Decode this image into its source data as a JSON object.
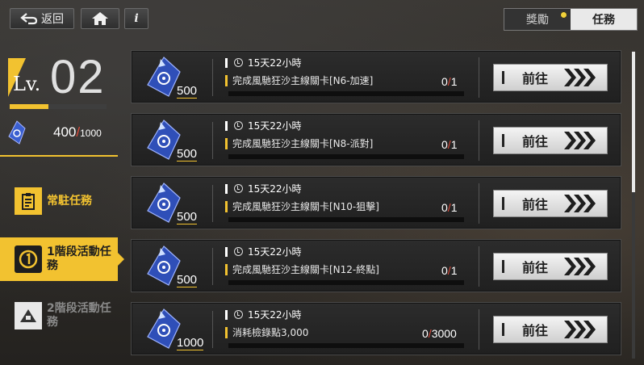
{
  "topbar": {
    "back_label": "返回",
    "info_label": "i",
    "tabs": [
      {
        "label": "獎勵"
      },
      {
        "label": "任務"
      }
    ]
  },
  "player": {
    "level_label": "Lv.",
    "level": "02",
    "level_progress": 0.4,
    "resource_current": "400",
    "resource_max": "1000"
  },
  "sidebar": {
    "items": [
      {
        "label_line1": "常駐任務",
        "label_line2": ""
      },
      {
        "label_line1": "1階段活動任",
        "label_line2": "務"
      },
      {
        "label_line1": "2階段活動任",
        "label_line2": "務"
      }
    ]
  },
  "tasks": [
    {
      "reward": "500",
      "time": "15天22小時",
      "desc": "完成風馳狂沙主線關卡[N6-加速]",
      "current": "0",
      "target": "1",
      "button": "前往"
    },
    {
      "reward": "500",
      "time": "15天22小時",
      "desc": "完成風馳狂沙主線關卡[N8-派對]",
      "current": "0",
      "target": "1",
      "button": "前往"
    },
    {
      "reward": "500",
      "time": "15天22小時",
      "desc": "完成風馳狂沙主線關卡[N10-狙擊]",
      "current": "0",
      "target": "1",
      "button": "前往"
    },
    {
      "reward": "500",
      "time": "15天22小時",
      "desc": "完成風馳狂沙主線關卡[N12-終點]",
      "current": "0",
      "target": "1",
      "button": "前往"
    },
    {
      "reward": "1000",
      "time": "15天22小時",
      "desc": "消耗檢錄點3,000",
      "current": "0",
      "target": "3000",
      "button": "前往"
    }
  ],
  "colors": {
    "accent": "#f2c230",
    "alert": "#e04a3a"
  },
  "icons": [
    "back-arrow-icon",
    "home-icon",
    "info-icon",
    "clock-icon",
    "ticket-icon",
    "clipboard-icon",
    "stage-one-icon",
    "warning-triangle-icon",
    "chevron-right-icon"
  ]
}
